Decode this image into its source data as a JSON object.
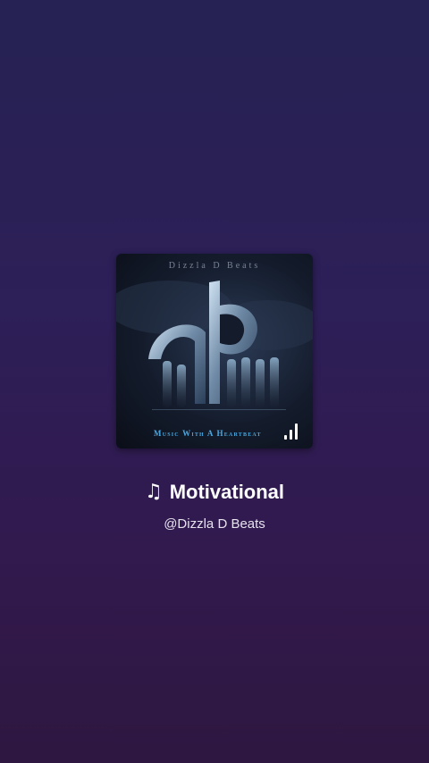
{
  "track": {
    "title": "Motivational",
    "artist": "@Dizzla D Beats",
    "note_icon": "music-note-icon",
    "note_glyph": "♫"
  },
  "cover": {
    "top_text": "Dizzla D Beats",
    "tagline": "Music With A Heartbeat",
    "signal_icon": "signal-bars-icon"
  },
  "colors": {
    "background_top": "#262253",
    "background_bottom": "#2e1740",
    "tagline_blue": "#4aa8e0"
  }
}
